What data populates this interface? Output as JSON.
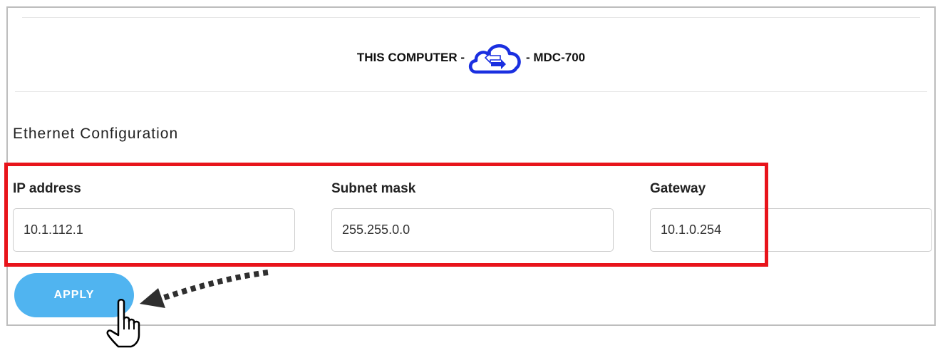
{
  "header": {
    "left_text": "THIS COMPUTER -",
    "right_text": "- MDC-700",
    "icon": "cloud-sync-icon",
    "icon_color": "#1a2fe0"
  },
  "section": {
    "title": "Ethernet Configuration"
  },
  "fields": {
    "ip": {
      "label": "IP address",
      "value": "10.1.112.1"
    },
    "subnet": {
      "label": "Subnet mask",
      "value": "255.255.0.0"
    },
    "gateway": {
      "label": "Gateway",
      "value": "10.1.0.254"
    }
  },
  "apply": {
    "label": "APPLY",
    "color": "#50b4f0"
  },
  "annotation": {
    "highlight_color": "#e8141b",
    "arrow": "dashed-arrow-icon",
    "cursor": "hand-pointer-icon"
  }
}
